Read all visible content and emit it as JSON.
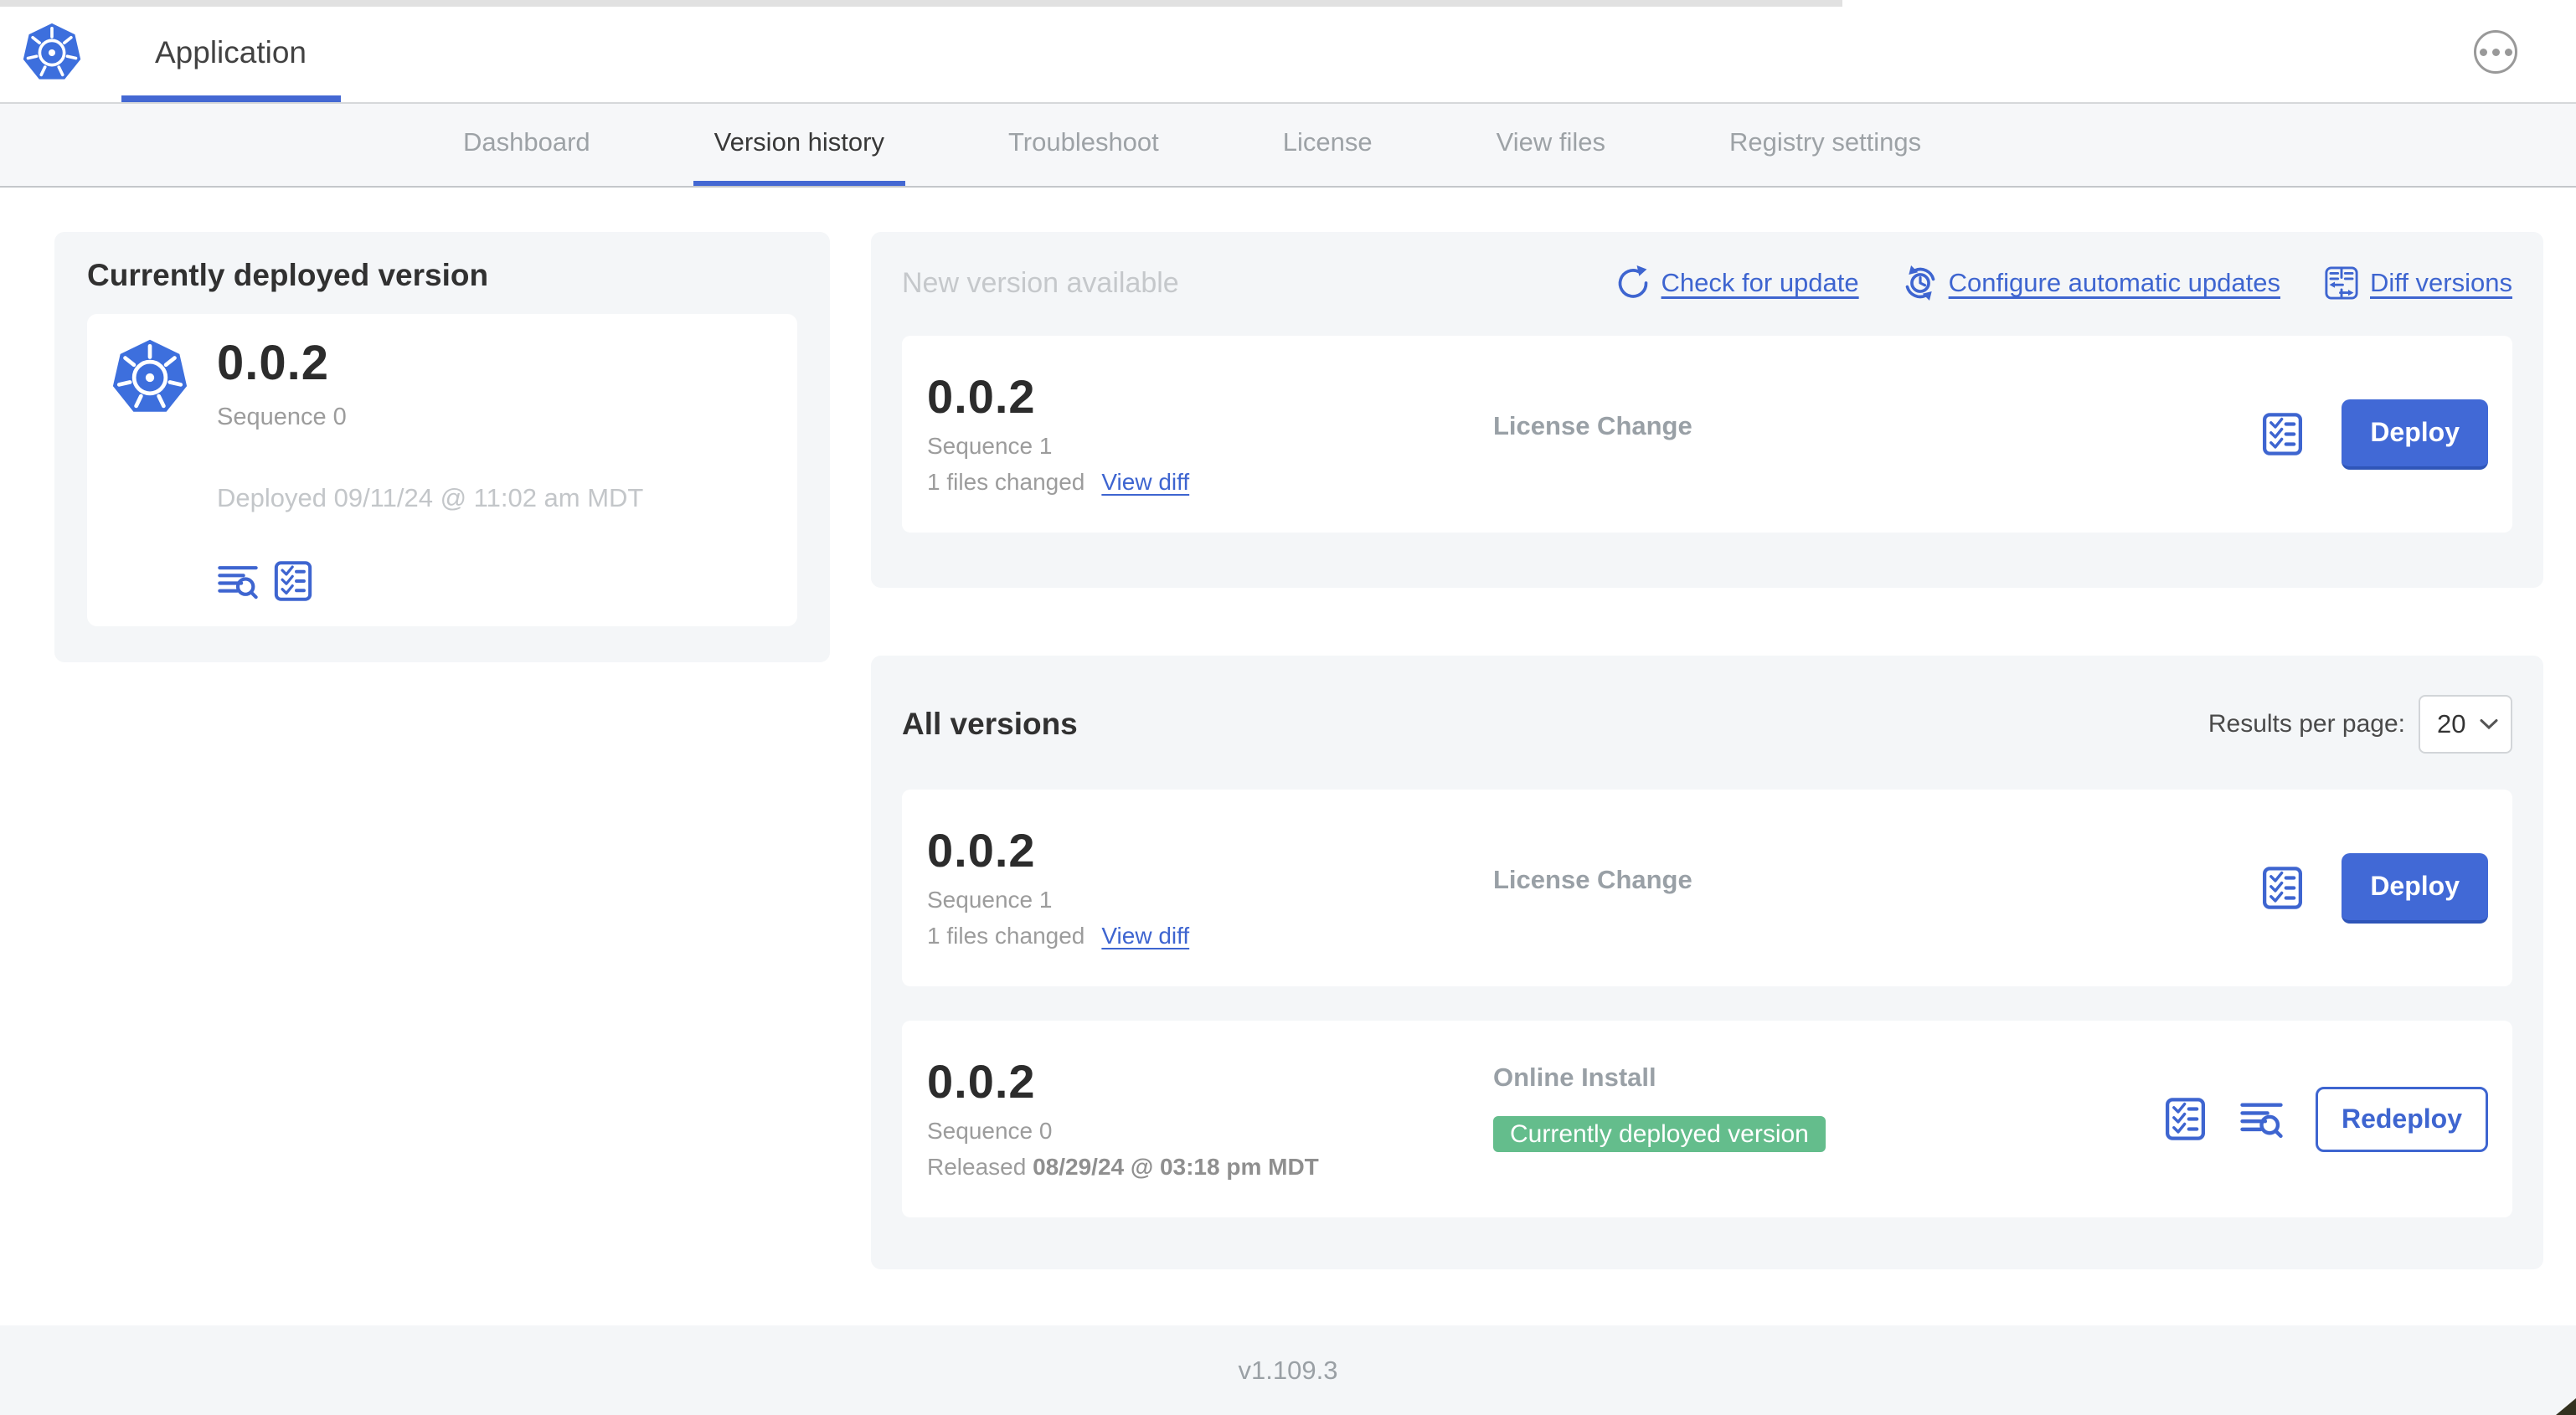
{
  "header": {
    "app_title": "Application",
    "logo_icon": "kubernetes-logo-icon",
    "more_menu_icon": "ellipsis-icon"
  },
  "tabs": [
    {
      "label": "Dashboard"
    },
    {
      "label": "Version history"
    },
    {
      "label": "Troubleshoot"
    },
    {
      "label": "License"
    },
    {
      "label": "View files"
    },
    {
      "label": "Registry settings"
    }
  ],
  "active_tab": "Version history",
  "deployed_card": {
    "title": "Currently deployed version",
    "version": "0.0.2",
    "sequence": "Sequence 0",
    "deployed_at": "Deployed 09/11/24 @ 11:02 am MDT",
    "icons": [
      "logs-icon",
      "preflight-checklist-icon"
    ]
  },
  "new_version": {
    "title": "New version available",
    "actions": [
      {
        "label": "Check for update",
        "icon": "refresh-icon"
      },
      {
        "label": "Configure automatic updates",
        "icon": "auto-update-clock-icon"
      },
      {
        "label": "Diff versions",
        "icon": "diff-icon"
      }
    ],
    "row": {
      "version": "0.0.2",
      "sequence": "Sequence 1",
      "files_changed": "1 files changed",
      "view_diff_label": "View diff",
      "source": "License Change",
      "deploy_label": "Deploy",
      "icons": [
        "preflight-checklist-icon"
      ]
    }
  },
  "all_versions": {
    "title": "All versions",
    "results_per_page_label": "Results per page:",
    "results_per_page_value": "20",
    "rows": [
      {
        "version": "0.0.2",
        "sequence": "Sequence 1",
        "files_changed": "1 files changed",
        "view_diff_label": "View diff",
        "source": "License Change",
        "action_label": "Deploy",
        "icons": [
          "preflight-checklist-icon"
        ]
      },
      {
        "version": "0.0.2",
        "sequence": "Sequence 0",
        "released_label": "Released",
        "released_date": "08/29/24 @ 03:18 pm MDT",
        "source": "Online Install",
        "badge": "Currently deployed version",
        "action_label": "Redeploy",
        "icons": [
          "preflight-checklist-icon",
          "logs-icon"
        ]
      }
    ]
  },
  "footer": {
    "version": "v1.109.3"
  },
  "colors": {
    "primary_blue": "#3e65d0",
    "button_blue": "#4169d6",
    "badge_green": "#64bd8c",
    "kubernetes_blue": "#3d6fdd",
    "section_bg": "#f4f6f8"
  }
}
